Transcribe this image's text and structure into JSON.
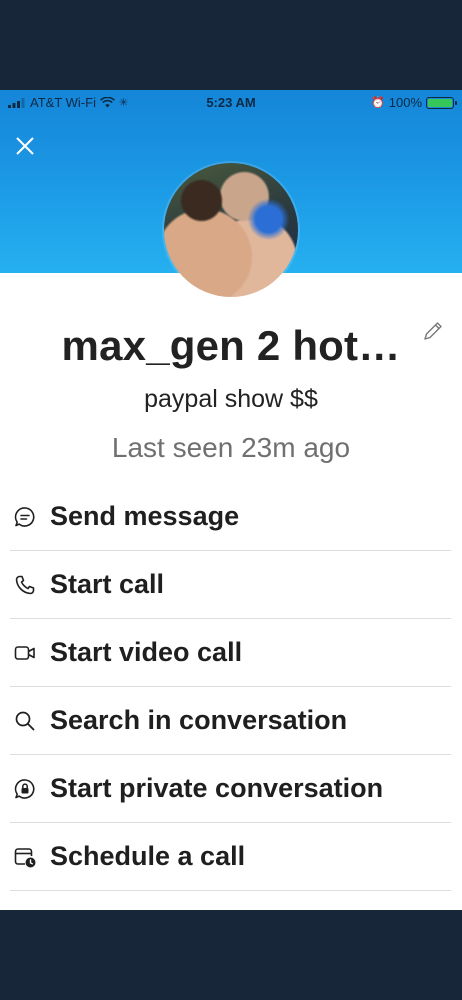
{
  "status_bar": {
    "carrier": "AT&T Wi-Fi",
    "time": "5:23 AM",
    "battery": "100%"
  },
  "profile": {
    "name": "max_gen 2 hot…",
    "status_message": "paypal show $$",
    "last_seen": "Last seen 23m ago"
  },
  "actions": [
    {
      "label": "Send message",
      "icon": "message-icon"
    },
    {
      "label": "Start call",
      "icon": "phone-icon"
    },
    {
      "label": "Start video call",
      "icon": "video-icon"
    },
    {
      "label": "Search in conversation",
      "icon": "search-icon"
    },
    {
      "label": "Start private conversation",
      "icon": "lock-chat-icon"
    },
    {
      "label": "Schedule a call",
      "icon": "calendar-clock-icon"
    }
  ],
  "colors": {
    "header_gradient_top": "#1585d8",
    "header_gradient_bottom": "#26b0f0",
    "battery_fill": "#35c759",
    "frame": "#18263a"
  }
}
